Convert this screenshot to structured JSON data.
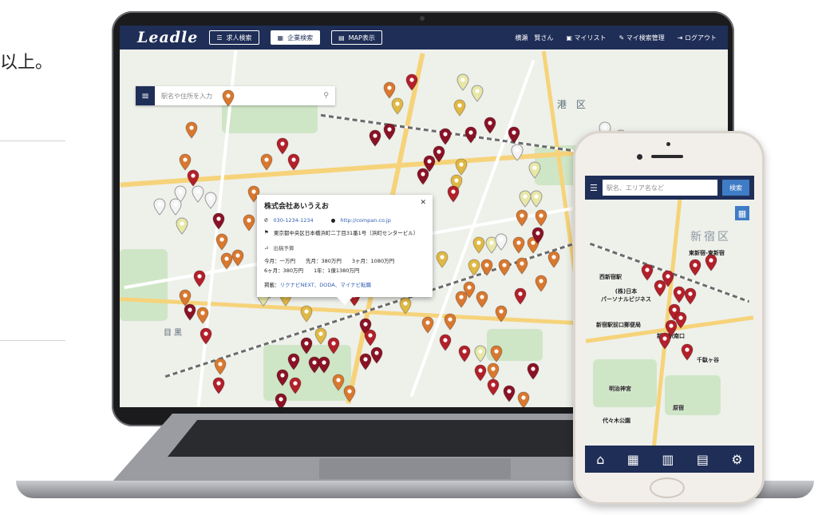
{
  "page": {
    "fragment_text": "以上。"
  },
  "laptop": {
    "header": {
      "logo": "Leadle",
      "nav": [
        {
          "label": "求人検索",
          "icon": "list-icon",
          "active": false
        },
        {
          "label": "企業検索",
          "icon": "building-icon",
          "active": true
        },
        {
          "label": "MAP表示",
          "icon": "map-icon",
          "active": false
        }
      ],
      "user": "横瀬　賢さん",
      "mylist": "マイリスト",
      "my_search": "マイ検索管理",
      "logout": "ログアウト"
    },
    "search": {
      "placeholder": "駅名や住所を入力"
    },
    "map_labels": {
      "minato": "港 区",
      "meguro": "目黒"
    },
    "popup": {
      "company": "株式会社あいうえお",
      "phone": "030-1234-1234",
      "url": "http://compan.co.jp",
      "address": "東京都中央区日本橋浜町二丁目31番1号（浜町センタービル）",
      "section_title": "出稿予算",
      "budget_line1": "今月：一万円　　先月：380万円　　3ヶ月：1080万円",
      "budget_line2": "6ヶ月：380万円　　1年：1億1380万円",
      "media_label": "掲載：",
      "media_value": "リクナビNEXT、DODA、マイナビ転職"
    },
    "pin_colors": {
      "dark": "#8a1225",
      "red": "#b3202a",
      "orange": "#d9782f",
      "yellow": "#e0b845",
      "light": "#e8e7a6",
      "white": "#f4f4f4"
    }
  },
  "phone": {
    "search_placeholder": "駅名、エリア名など",
    "search_button": "検索",
    "map_labels": {
      "shinjuku_ku": "新宿区",
      "nishi_shinjuku": "西新宿駅",
      "higashi_shinjuku": "東新宿-東新宿",
      "persol": "(株)日本\nパーソナルビジネス",
      "shinjuku_post": "新宿駅前口郵便局",
      "shinjuku_sta": "新宿駅南口",
      "meiji_jingu": "明治神宮",
      "yoyogi": "代々木公園",
      "harajuku": "原宿",
      "sendagaya": "千駄ヶ谷"
    },
    "tabs": [
      "home-icon",
      "building-icon",
      "map-icon",
      "list-icon",
      "gear-icon"
    ]
  }
}
